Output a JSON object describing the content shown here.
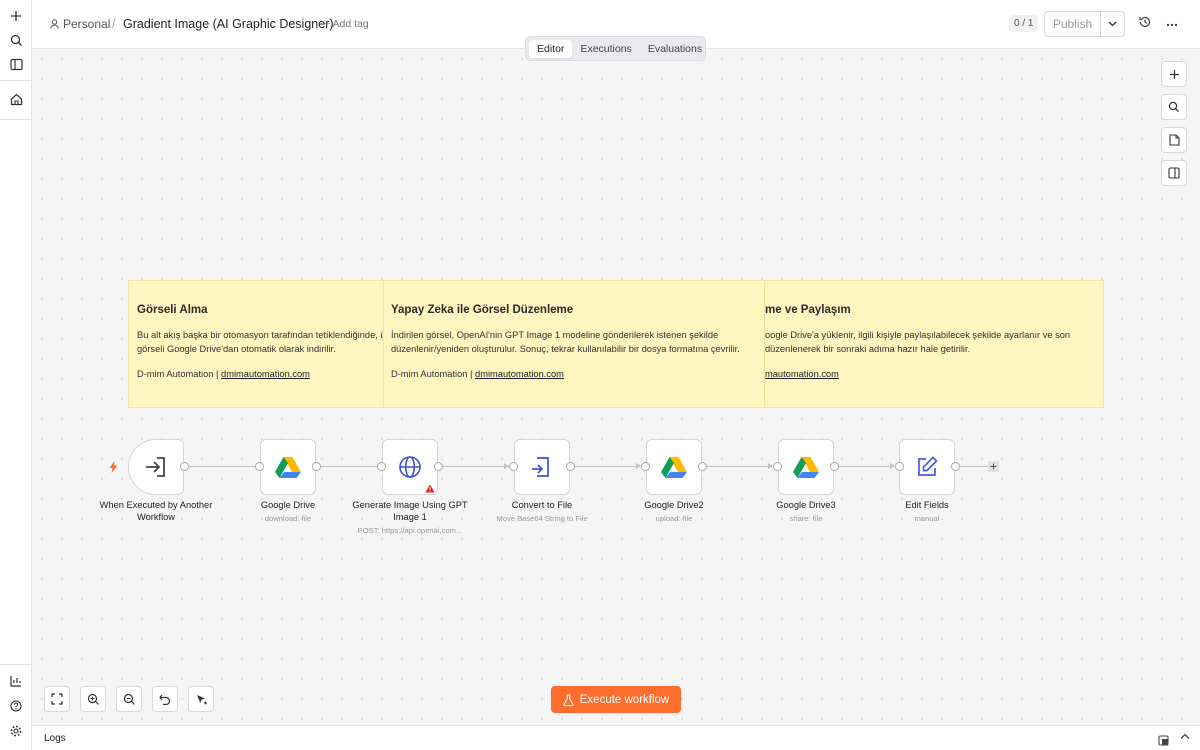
{
  "header": {
    "project": "Personal",
    "separator": "/",
    "workflow_title": "Gradient Image (AI Graphic Designer)",
    "add_tag": "+ Add tag",
    "version": "0 / 1",
    "publish_label": "Publish"
  },
  "tabs": [
    {
      "label": "Editor",
      "active": true
    },
    {
      "label": "Executions",
      "active": false
    },
    {
      "label": "Evaluations",
      "active": false
    }
  ],
  "sticky_notes": [
    {
      "title": "Görseli Alma",
      "body": "Bu alt akış başka bir otomasyon tarafından tetiklendiğinde, ürün/tasarım görseli Google Drive'dan otomatik olarak indirilir.",
      "signature_prefix": "D-mim Automation | ",
      "link": "dmimautomation.com"
    },
    {
      "title": "Yapay Zeka ile Görsel Düzenleme",
      "body": "İndirilen görsel, OpenAI'nin GPT Image 1 modeline gönderilerek istenen şekilde düzenlenir/yeniden oluşturulur. Sonuç, tekrar kullanılabilir bir dosya formatına çevrilir.",
      "signature_prefix": "D-mim Automation | ",
      "link": "dmimautomation.com"
    },
    {
      "title": "me ve Paylaşım",
      "body": "oogle Drive'a yüklenir, ilgili kişiyle paylaşılabilecek şekilde ayarlanır ve son düzenlenerek bir sonraki adıma hazır hale getirilir.",
      "signature_prefix": "",
      "link": "mautomation.com"
    }
  ],
  "nodes": [
    {
      "name": "When Executed by Another Workflow",
      "subtitle": "",
      "icon": "sign-in-icon"
    },
    {
      "name": "Google Drive",
      "subtitle": "download: file",
      "icon": "google-drive-icon"
    },
    {
      "name": "Generate Image Using GPT Image 1",
      "subtitle": "POST: https://api.openai.com...",
      "icon": "globe-icon"
    },
    {
      "name": "Convert to File",
      "subtitle": "Move Base64 String to File",
      "icon": "file-import-icon"
    },
    {
      "name": "Google Drive2",
      "subtitle": "upload: file",
      "icon": "google-drive-icon"
    },
    {
      "name": "Google Drive3",
      "subtitle": "share: file",
      "icon": "google-drive-icon"
    },
    {
      "name": "Edit Fields",
      "subtitle": "manual",
      "icon": "pen-square-icon"
    }
  ],
  "execute_label": "Execute workflow",
  "logs_label": "Logs",
  "colors": {
    "accent": "#ff6d2e",
    "sticky_bg": "#fff5c0",
    "warning": "#e02424",
    "edit_icon": "#4a5ae8"
  }
}
